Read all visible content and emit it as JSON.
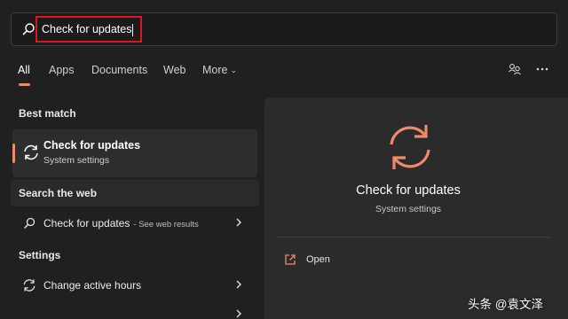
{
  "search": {
    "query": "Check for updates"
  },
  "tabs": [
    {
      "label": "All",
      "active": true
    },
    {
      "label": "Apps"
    },
    {
      "label": "Documents"
    },
    {
      "label": "Web"
    },
    {
      "label": "More",
      "has_dropdown": true
    }
  ],
  "top_right_icons": [
    "account-switch-icon",
    "more-options-icon"
  ],
  "best_match": {
    "heading": "Best match",
    "title": "Check for updates",
    "subtitle": "System settings",
    "icon": "sync-icon"
  },
  "search_web": {
    "heading": "Search the web",
    "item": {
      "label": "Check for updates",
      "hint": "- See web results",
      "icon": "search-icon"
    }
  },
  "settings": {
    "heading": "Settings",
    "items": [
      {
        "label": "Change active hours",
        "icon": "sync-icon"
      }
    ]
  },
  "preview": {
    "title": "Check for updates",
    "subtitle": "System settings",
    "action_open": "Open"
  },
  "watermark": "头条 @袁文泽",
  "colors": {
    "accent": "#f08a6c",
    "highlight_border": "#e0141e",
    "background": "#202020",
    "panel": "#2b2b2b"
  }
}
